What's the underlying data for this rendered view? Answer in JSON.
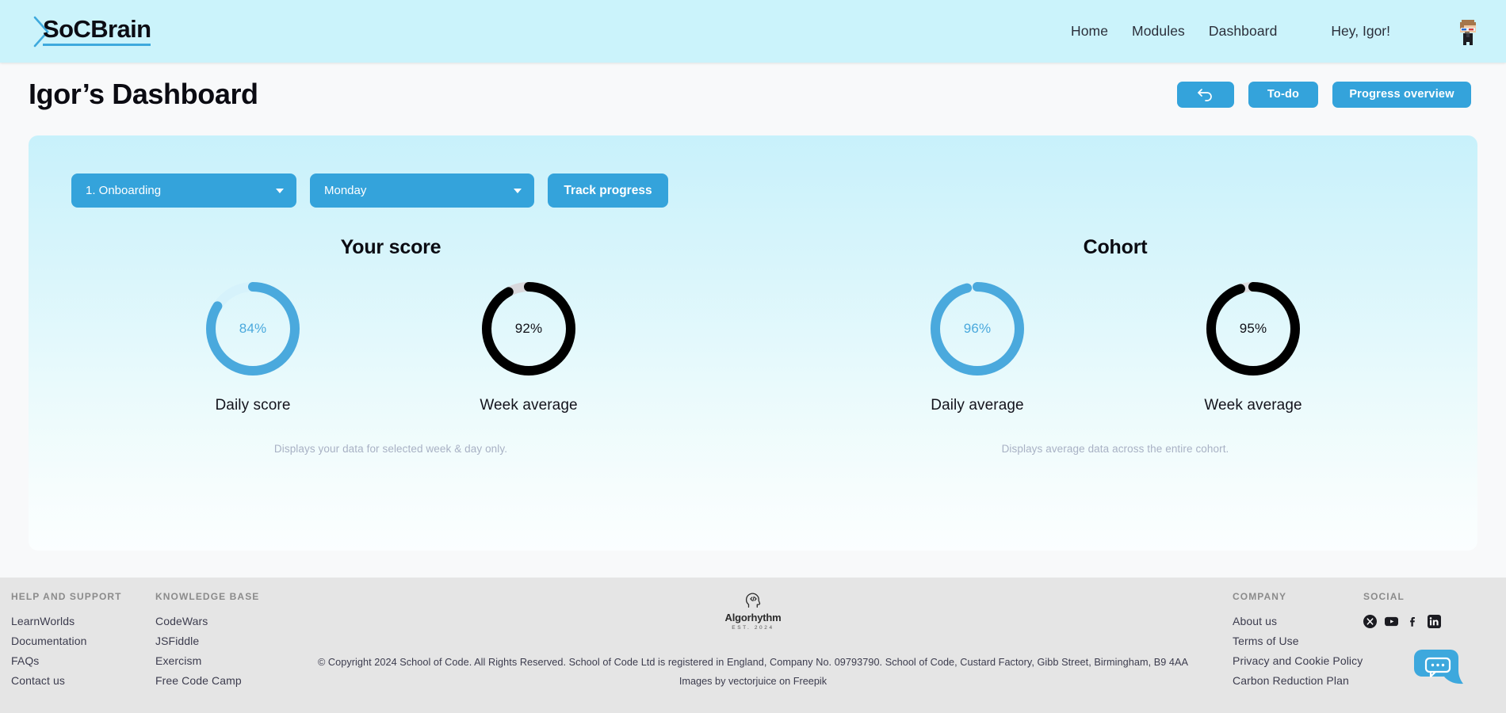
{
  "header": {
    "logo_text": "SoCBrain",
    "nav": [
      {
        "label": "Home",
        "name": "home"
      },
      {
        "label": "Modules",
        "name": "modules"
      },
      {
        "label": "Dashboard",
        "name": "dashboard"
      }
    ],
    "greeting": "Hey, Igor!",
    "avatar_alt": "user-avatar"
  },
  "page": {
    "title": "Igor’s Dashboard",
    "back_icon": "undo-arrow-icon",
    "todo_label": "To-do",
    "progress_label": "Progress overview"
  },
  "controls": {
    "module_value": "1. Onboarding",
    "day_value": "Monday",
    "track_label": "Track progress"
  },
  "groups": [
    {
      "title": "Your score",
      "note": "Displays your data for selected week & day only.",
      "rings": [
        {
          "value": 84,
          "display": "84%",
          "label": "Daily score",
          "color": "#4aa9dd",
          "track": "#d6f2fb",
          "text_color": "#4aa9dd"
        },
        {
          "value": 92,
          "display": "92%",
          "label": "Week average",
          "color": "#000000",
          "track": "#d8d8dc",
          "text_color": "#111118"
        }
      ]
    },
    {
      "title": "Cohort",
      "note": "Displays average data across the entire cohort.",
      "rings": [
        {
          "value": 96,
          "display": "96%",
          "label": "Daily average",
          "color": "#4aa9dd",
          "track": "#dff5fb",
          "text_color": "#4aa9dd"
        },
        {
          "value": 95,
          "display": "95%",
          "label": "Week average",
          "color": "#000000",
          "track": "#dcdcdf",
          "text_color": "#111118"
        }
      ]
    }
  ],
  "chart_data": {
    "type": "pie",
    "title": "Dashboard progress rings",
    "series": [
      {
        "name": "Your score — Daily score",
        "value": 84,
        "max": 100
      },
      {
        "name": "Your score — Week average",
        "value": 92,
        "max": 100
      },
      {
        "name": "Cohort — Daily average",
        "value": 96,
        "max": 100
      },
      {
        "name": "Cohort — Week average",
        "value": 95,
        "max": 100
      }
    ]
  },
  "footer": {
    "columns": [
      {
        "heading": "HELP AND SUPPORT",
        "links": [
          "LearnWorlds",
          "Documentation",
          "FAQs",
          "Contact us"
        ]
      },
      {
        "heading": "KNOWLEDGE BASE",
        "links": [
          "CodeWars",
          "JSFiddle",
          "Exercism",
          "Free Code Camp"
        ]
      },
      {
        "heading": "COMPANY",
        "links": [
          "About us",
          "Terms of Use",
          "Privacy and Cookie Policy",
          "Carbon Reduction Plan"
        ]
      }
    ],
    "social_heading": "SOCIAL",
    "social": [
      "x-icon",
      "youtube-icon",
      "facebook-icon",
      "linkedin-icon"
    ],
    "brand_name": "Algorhythm",
    "brand_est": "EST. 2024",
    "brand_icon": "head-code-icon",
    "copyright": "© Copyright 2024 School of Code. All Rights Reserved. School of Code Ltd is registered in England, Company No. 09793790. School of Code, Custard Factory, Gibb Street, Birmingham, B9 4AA",
    "images_credit": "Images by vectorjuice on Freepik",
    "chat_icon": "chat-bubble-icon"
  },
  "colors": {
    "accent": "#34a3db",
    "header_bg": "#cbf3fb",
    "panel_top": "#c8f1fb",
    "footer_bg": "#e5e5e5"
  }
}
